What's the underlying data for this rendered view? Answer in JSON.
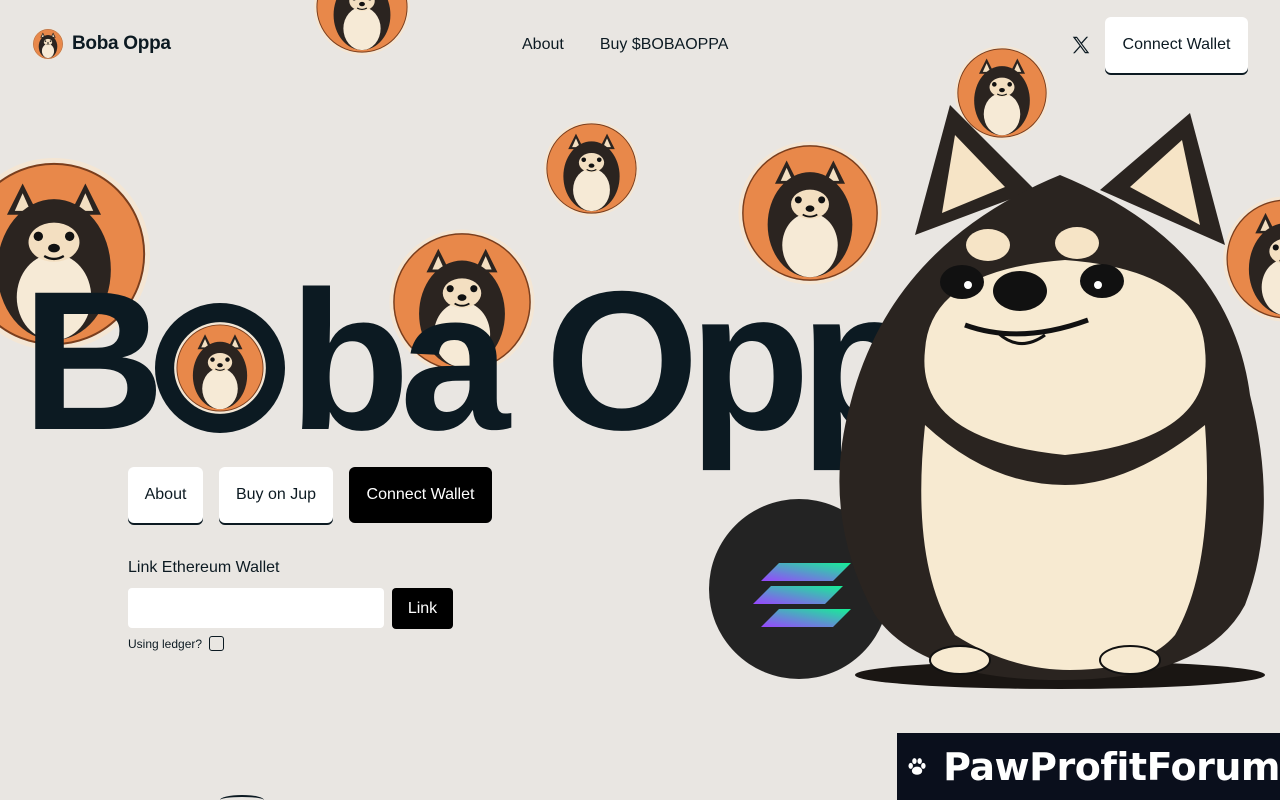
{
  "header": {
    "brand_name": "Boba Oppa",
    "nav": [
      "About",
      "Buy $BOBAOPPA"
    ],
    "social_icon": "x-twitter-icon",
    "connect_label": "Connect Wallet"
  },
  "hero": {
    "title_first_letter": "B",
    "title_rest": "ba Oppa"
  },
  "actions": {
    "about_label": "About",
    "buy_label": "Buy on Jup",
    "connect_label": "Connect Wallet"
  },
  "link_wallet": {
    "label": "Link Ethereum Wallet",
    "input_value": "",
    "button_label": "Link",
    "ledger_label": "Using ledger?",
    "ledger_checked": false
  },
  "decor": {
    "solana_icon": "solana-logo-icon",
    "mascot": "pomeranian-mascot"
  },
  "watermark": {
    "text": "PawProfitForum",
    "icon": "paw-icon"
  },
  "colors": {
    "background": "#e9e6e2",
    "text": "#0c1a22",
    "coin_orange": "#e8884a",
    "button_dark": "#000000",
    "solana_badge": "#232323"
  }
}
